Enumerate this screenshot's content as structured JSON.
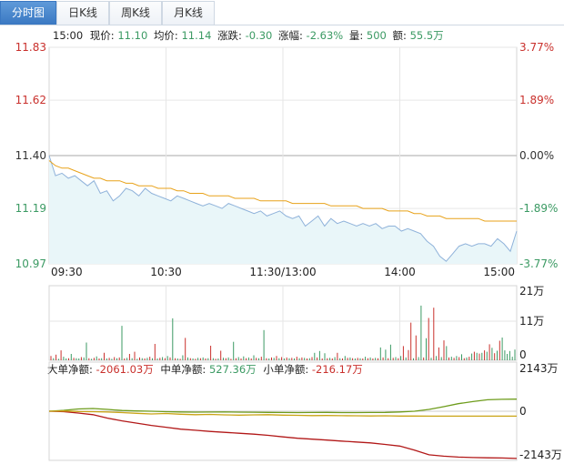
{
  "tabs": [
    {
      "label": "分时图",
      "active": true
    },
    {
      "label": "日K线",
      "active": false
    },
    {
      "label": "周K线",
      "active": false
    },
    {
      "label": "月K线",
      "active": false
    }
  ],
  "info_bar": {
    "time": "15:00",
    "price_label": "现价:",
    "price_value": "11.10",
    "avg_label": "均价:",
    "avg_value": "11.14",
    "change_label": "涨跌:",
    "change_value": "-0.30",
    "pct_label": "涨幅:",
    "pct_value": "-2.63%",
    "vol_label": "量:",
    "vol_value": "500",
    "amount_label": "额:",
    "amount_value": "55.5万"
  },
  "flow_bar": {
    "large_label": "大单净额:",
    "large_value": "-2061.03万",
    "medium_label": "中单净额:",
    "medium_value": "527.36万",
    "small_label": "小单净额:",
    "small_value": "-216.17万"
  },
  "colors": {
    "price_line": "#8fb2da",
    "avg_line": "#e8a21a",
    "area_fill": "#e9f6f9",
    "up": "#c9302c",
    "down": "#3b9a63",
    "large_flow": "#b21818",
    "medium_flow": "#6e9c1c",
    "small_flow": "#c9a416",
    "grid": "#e6e6e6"
  },
  "chart_data": [
    {
      "type": "line",
      "name": "分时价格",
      "x_labels": [
        "09:30",
        "10:30",
        "11:30/13:00",
        "14:00",
        "15:00"
      ],
      "y_ticks": [
        "11.83",
        "11.62",
        "11.40",
        "11.19",
        "10.97"
      ],
      "right_ticks": [
        "3.77%",
        "1.89%",
        "0.00%",
        "-1.89%",
        "-3.77%"
      ],
      "ylim": [
        10.97,
        11.83
      ],
      "prev_close": 11.4,
      "price_values": [
        11.4,
        11.32,
        11.33,
        11.31,
        11.32,
        11.3,
        11.28,
        11.3,
        11.25,
        11.26,
        11.22,
        11.24,
        11.27,
        11.26,
        11.24,
        11.27,
        11.25,
        11.24,
        11.23,
        11.22,
        11.24,
        11.23,
        11.22,
        11.21,
        11.2,
        11.21,
        11.2,
        11.19,
        11.21,
        11.2,
        11.19,
        11.18,
        11.17,
        11.18,
        11.16,
        11.17,
        11.18,
        11.16,
        11.15,
        11.16,
        11.12,
        11.14,
        11.16,
        11.12,
        11.15,
        11.13,
        11.14,
        11.13,
        11.12,
        11.13,
        11.12,
        11.13,
        11.11,
        11.12,
        11.12,
        11.1,
        11.11,
        11.1,
        11.09,
        11.06,
        11.04,
        11.0,
        10.98,
        11.01,
        11.04,
        11.05,
        11.04,
        11.05,
        11.05,
        11.04,
        11.07,
        11.05,
        11.02,
        11.1
      ],
      "avg_values": [
        11.38,
        11.36,
        11.35,
        11.35,
        11.34,
        11.33,
        11.32,
        11.31,
        11.31,
        11.3,
        11.3,
        11.3,
        11.29,
        11.29,
        11.28,
        11.28,
        11.28,
        11.27,
        11.27,
        11.27,
        11.26,
        11.26,
        11.25,
        11.25,
        11.25,
        11.24,
        11.24,
        11.24,
        11.24,
        11.23,
        11.23,
        11.23,
        11.23,
        11.22,
        11.22,
        11.22,
        11.22,
        11.22,
        11.21,
        11.21,
        11.21,
        11.21,
        11.21,
        11.21,
        11.2,
        11.2,
        11.2,
        11.2,
        11.2,
        11.19,
        11.19,
        11.19,
        11.19,
        11.18,
        11.18,
        11.18,
        11.18,
        11.17,
        11.17,
        11.16,
        11.16,
        11.16,
        11.15,
        11.15,
        11.15,
        11.15,
        11.15,
        11.15,
        11.14,
        11.14,
        11.14,
        11.14,
        11.14,
        11.14
      ]
    },
    {
      "type": "bar",
      "name": "成交量",
      "y_ticks": [
        "21万",
        "11万",
        "0"
      ],
      "ylim": [
        0,
        21
      ],
      "values": [
        1.2,
        0.6,
        1.6,
        0.4,
        2.8,
        1.0,
        0.5,
        0.6,
        1.8,
        0.7,
        0.6,
        0.5,
        0.9,
        0.8,
        5.0,
        0.6,
        0.4,
        0.7,
        1.1,
        0.5,
        0.6,
        2.1,
        0.5,
        0.7,
        0.4,
        0.9,
        0.6,
        0.8,
        9.7,
        0.5,
        0.7,
        1.8,
        0.6,
        2.4,
        0.4,
        0.8,
        0.6,
        0.5,
        0.7,
        1.0,
        0.6,
        4.6,
        0.5,
        0.7,
        0.9,
        0.6,
        1.2,
        0.8,
        11.8,
        0.6,
        0.5,
        0.4,
        1.4,
        6.3,
        0.8,
        0.6,
        0.5,
        0.4,
        0.7,
        0.6,
        0.8,
        0.5,
        0.6,
        4.1,
        0.6,
        0.4,
        0.5,
        2.7,
        0.7,
        0.6,
        0.8,
        0.4,
        5.2,
        0.6,
        0.9,
        0.5,
        1.1,
        0.6,
        0.8,
        0.5,
        1.4,
        0.7,
        0.6,
        1.0,
        8.5,
        0.6,
        0.5,
        0.8,
        0.7,
        1.2,
        0.6,
        0.9,
        0.5,
        0.8,
        0.6,
        0.7,
        0.5,
        1.0,
        0.6,
        0.8,
        0.7,
        0.5,
        0.6,
        0.9,
        2.1,
        0.8,
        2.6,
        0.5,
        2.0,
        0.6,
        0.7,
        0.5,
        0.9,
        2.1,
        0.6,
        0.5,
        1.2,
        0.7,
        0.8,
        0.6,
        0.5,
        0.7,
        0.6,
        0.5,
        1.0,
        0.6,
        0.8,
        0.5,
        0.7,
        0.6,
        3.6,
        0.8,
        3.0,
        0.6,
        4.4,
        0.7,
        0.9,
        0.6,
        1.2,
        4.0,
        0.8,
        2.9,
        10.6,
        0.6,
        7.0,
        0.9,
        15.4,
        0.8,
        6.2,
        11.9,
        0.7,
        14.8,
        1.2,
        3.6,
        0.9,
        5.6,
        4.0,
        0.8,
        1.0,
        0.7,
        1.2,
        0.9,
        1.7,
        0.6,
        0.8,
        1.0,
        1.9,
        2.4,
        2.1,
        1.9,
        2.1,
        2.8,
        2.4,
        4.5,
        3.5,
        2.0,
        2.7,
        5.5,
        6.4,
        2.8,
        1.8,
        2.6,
        1.0,
        3.0
      ],
      "up_flags": [
        1,
        0,
        1,
        0,
        1,
        0,
        0,
        1,
        0,
        1,
        0,
        0,
        1,
        0,
        0,
        1,
        0,
        1,
        0,
        1,
        0,
        1,
        0,
        1,
        0,
        1,
        0,
        1,
        0,
        1,
        0,
        1,
        0,
        1,
        0,
        1,
        0,
        1,
        0,
        1,
        0,
        1,
        0,
        1,
        0,
        1,
        0,
        1,
        0,
        1,
        0,
        1,
        0,
        1,
        0,
        1,
        0,
        1,
        0,
        1,
        0,
        1,
        0,
        1,
        0,
        1,
        0,
        1,
        0,
        1,
        0,
        1,
        0,
        1,
        0,
        1,
        0,
        1,
        0,
        1,
        0,
        1,
        0,
        1,
        0,
        1,
        0,
        1,
        0,
        1,
        0,
        1,
        0,
        1,
        0,
        1,
        0,
        1,
        0,
        1,
        0,
        1,
        0,
        1,
        0,
        1,
        0,
        1,
        0,
        1,
        0,
        1,
        0,
        1,
        0,
        1,
        0,
        1,
        0,
        1,
        0,
        1,
        0,
        1,
        0,
        1,
        0,
        1,
        0,
        1,
        0,
        1,
        0,
        1,
        0,
        1,
        0,
        1,
        0,
        1,
        0,
        1,
        1,
        0,
        1,
        0,
        0,
        1,
        0,
        1,
        0,
        1,
        0,
        1,
        0,
        1,
        0,
        1,
        0,
        1,
        0,
        1,
        0,
        1,
        0,
        1,
        0,
        1,
        0,
        1,
        0,
        1,
        0,
        1,
        0,
        1,
        0,
        1
      ]
    },
    {
      "type": "line",
      "name": "资金净额",
      "y_ticks": [
        "2143万",
        "0",
        "-2143万"
      ],
      "ylim": [
        -2143,
        2143
      ],
      "series": [
        {
          "name": "大单净额",
          "values": [
            0,
            -20,
            -80,
            -150,
            -300,
            -420,
            -520,
            -620,
            -700,
            -780,
            -830,
            -880,
            -920,
            -960,
            -1000,
            -1050,
            -1120,
            -1180,
            -1220,
            -1260,
            -1300,
            -1340,
            -1380,
            -1450,
            -1520,
            -1700,
            -1900,
            -1960,
            -2000,
            -2020,
            -2030,
            -2040,
            -2061
          ]
        },
        {
          "name": "中单净额",
          "values": [
            0,
            40,
            100,
            120,
            80,
            30,
            10,
            0,
            -20,
            -30,
            -40,
            -35,
            -30,
            -40,
            -45,
            -50,
            -55,
            -60,
            -55,
            -50,
            -60,
            -60,
            -55,
            -50,
            -30,
            0,
            80,
            200,
            330,
            420,
            500,
            520,
            527
          ]
        },
        {
          "name": "小单净额",
          "values": [
            0,
            10,
            -10,
            -20,
            -30,
            -60,
            -90,
            -120,
            -100,
            -130,
            -150,
            -140,
            -160,
            -170,
            -160,
            -150,
            -170,
            -180,
            -190,
            -185,
            -195,
            -200,
            -205,
            -200,
            -210,
            -212,
            -214,
            -215,
            -216,
            -216,
            -216,
            -216,
            -216
          ]
        }
      ]
    }
  ]
}
